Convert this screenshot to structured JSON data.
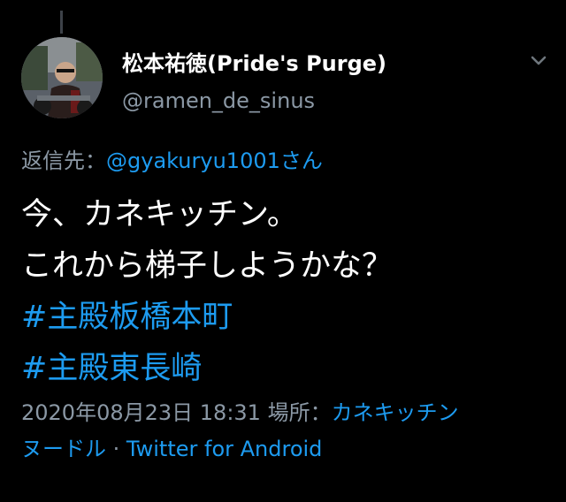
{
  "tweet": {
    "author": {
      "display_name": "松本祐徳(Pride's Purge)",
      "handle": "@ramen_de_sinus",
      "avatar_icon": "user-avatar-photo"
    },
    "menu_icon": "chevron-down-icon",
    "reply": {
      "prefix": "返信先：",
      "mention": "@gyakuryu1001さん"
    },
    "body_lines": [
      "今、カネキッチン。",
      "これから梯子しようかな？"
    ],
    "hashtags": [
      "#主殿板橋本町",
      "#主殿東長崎"
    ],
    "meta": {
      "timestamp": "2020年08月23日 18:31",
      "location_label": "場所：",
      "location_part1": "カネキッチン",
      "location_part2": "ヌードル",
      "separator": "·",
      "client": "Twitter for Android"
    }
  },
  "colors": {
    "background": "#000000",
    "text_primary": "#ffffff",
    "text_secondary": "#8b98a5",
    "link": "#1d9bf0",
    "thread_line": "#3d4248"
  }
}
